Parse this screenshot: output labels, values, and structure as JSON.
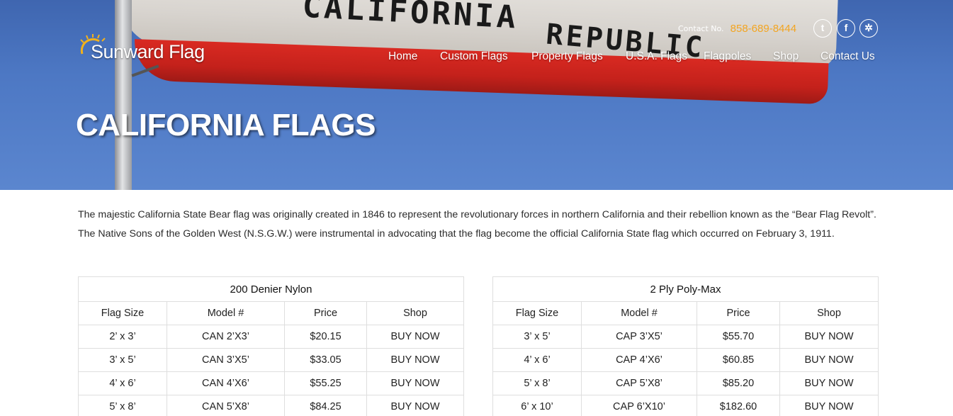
{
  "header": {
    "logo_text": "Sunward Flag",
    "contact_label": "Contact No.",
    "phone": "858-689-8444",
    "social": [
      {
        "name": "twitter",
        "glyph": "t"
      },
      {
        "name": "facebook",
        "glyph": "f"
      },
      {
        "name": "yelp",
        "glyph": "✲"
      }
    ],
    "nav": [
      "Home",
      "Custom Flags",
      "Property Flags",
      "U.S.A. Flags",
      "Flagpoles",
      "Shop",
      "Contact Us"
    ],
    "hero_flag_text": [
      "CALIFORNIA",
      "REPUBLIC"
    ]
  },
  "page_title": "CALIFORNIA FLAGS",
  "intro": "The majestic California State Bear flag was originally created in 1846 to represent the revolutionary forces in northern California and their rebellion known as the “Bear Flag Revolt”. The Native Sons of the Golden West (N.S.G.W.) were instrumental in advocating that the flag become the official California State flag which occurred on February 3, 1911.",
  "tables": [
    {
      "title": "200 Denier Nylon",
      "columns": [
        "Flag Size",
        "Model #",
        "Price",
        "Shop"
      ],
      "rows": [
        [
          "2’ x 3’",
          "CAN 2’X3’",
          "$20.15",
          "BUY NOW"
        ],
        [
          "3’ x 5’",
          "CAN 3’X5’",
          "$33.05",
          "BUY NOW"
        ],
        [
          "4’ x 6’",
          "CAN 4’X6’",
          "$55.25",
          "BUY NOW"
        ],
        [
          "5’ x 8’",
          "CAN 5’X8’",
          "$84.25",
          "BUY NOW"
        ]
      ]
    },
    {
      "title": "2 Ply Poly-Max",
      "columns": [
        "Flag Size",
        "Model #",
        "Price",
        "Shop"
      ],
      "rows": [
        [
          "3’ x 5’",
          "CAP 3’X5’",
          "$55.70",
          "BUY NOW"
        ],
        [
          "4’ x 6’",
          "CAP 4’X6’",
          "$60.85",
          "BUY NOW"
        ],
        [
          "5’ x 8’",
          "CAP 5’X8’",
          "$85.20",
          "BUY NOW"
        ],
        [
          "6’ x 10’",
          "CAP 6’X10’",
          "$182.60",
          "BUY NOW"
        ]
      ]
    }
  ],
  "colors": {
    "hero_sky": "#4d78c4",
    "phone": "#f3a521",
    "table_border": "#dedede"
  }
}
